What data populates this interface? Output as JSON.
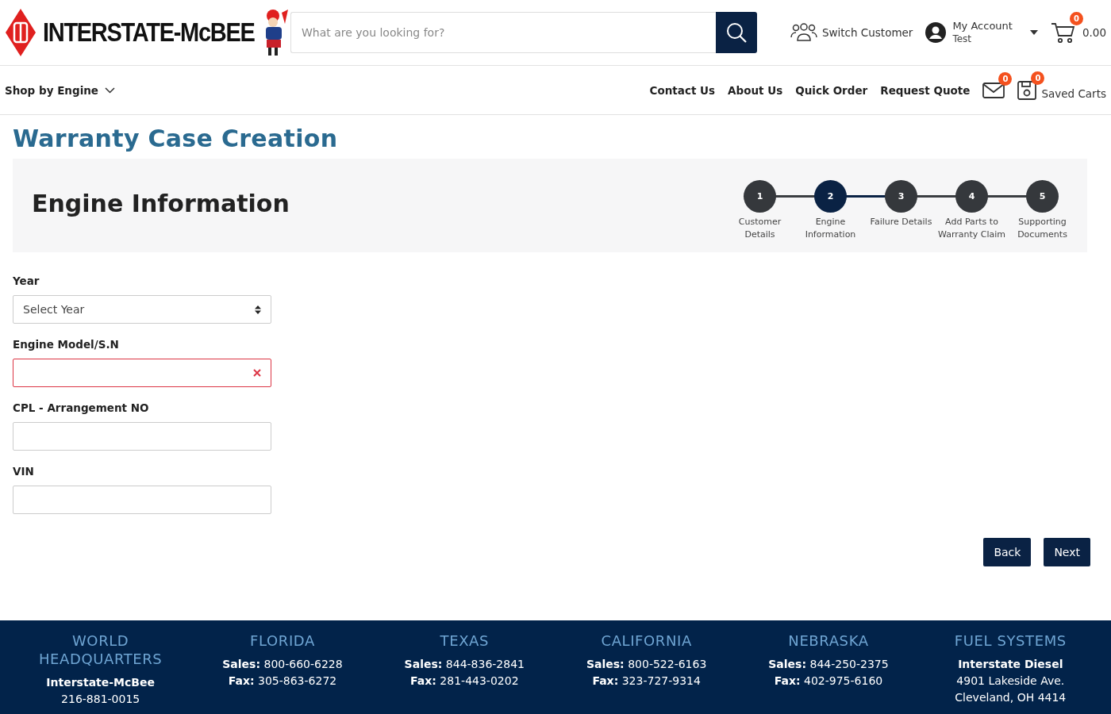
{
  "header": {
    "logo_text": "INTERSTATE-McBEE",
    "search": {
      "placeholder": "What are you looking for?"
    },
    "switch_customer": "Switch Customer",
    "account": {
      "label": "My Account",
      "user": "Test"
    },
    "cart": {
      "count": "0",
      "total": "0.00"
    }
  },
  "nav": {
    "shop_by": "Shop by Engine",
    "links": [
      "Contact Us",
      "About Us",
      "Quick Order",
      "Request Quote"
    ],
    "messages_count": "0",
    "saved_carts": {
      "count": "0",
      "label": "Saved Carts"
    }
  },
  "page_title": "Warranty Case Creation",
  "section_title": "Engine Information",
  "steps": [
    {
      "number": "1",
      "label": "Customer Details",
      "selected": false
    },
    {
      "number": "2",
      "label": "Engine Information",
      "selected": true
    },
    {
      "number": "3",
      "label": "Failure Details",
      "selected": false
    },
    {
      "number": "4",
      "label": "Add Parts to Warranty Claim",
      "selected": false
    },
    {
      "number": "5",
      "label": "Supporting Documents",
      "selected": false
    }
  ],
  "fields": [
    {
      "label": "Year",
      "kind": "select",
      "value": "Select Year",
      "invalid": false
    },
    {
      "label": "Engine Model/S.N",
      "kind": "text",
      "invalid": true
    },
    {
      "label": "CPL - Arrangement NO",
      "kind": "text",
      "invalid": false
    },
    {
      "label": "VIN",
      "kind": "text",
      "invalid": false
    }
  ],
  "buttons": [
    "Back",
    "Next"
  ],
  "footer": [
    {
      "title": "WORLD HEADQUARTERS",
      "lines": [
        {
          "text": "Interstate-McBee",
          "kind": "name"
        },
        {
          "text": "216-881-0015",
          "kind": "plain"
        }
      ]
    },
    {
      "title": "FLORIDA",
      "lines": [
        {
          "text": "**Sales:** 800-660-6228",
          "kind": "plain"
        },
        {
          "text": "**Fax:** 305-863-6272",
          "kind": "plain"
        }
      ]
    },
    {
      "title": "TEXAS",
      "lines": [
        {
          "text": "**Sales:** 844-836-2841",
          "kind": "plain"
        },
        {
          "text": "**Fax:** 281-443-0202",
          "kind": "plain"
        }
      ]
    },
    {
      "title": "CALIFORNIA",
      "lines": [
        {
          "text": "**Sales:** 800-522-6163",
          "kind": "plain"
        },
        {
          "text": "**Fax:** 323-727-9314",
          "kind": "plain"
        }
      ]
    },
    {
      "title": "NEBRASKA",
      "lines": [
        {
          "text": "**Sales:** 844-250-2375",
          "kind": "plain"
        },
        {
          "text": "**Fax:** 402-975-6160",
          "kind": "plain"
        }
      ]
    },
    {
      "title": "FUEL SYSTEMS",
      "lines": [
        {
          "text": "Interstate Diesel",
          "kind": "name"
        },
        {
          "text": "4901 Lakeside Ave.",
          "kind": "plain"
        },
        {
          "text": "Cleveland, OH 4414",
          "kind": "plain"
        }
      ]
    }
  ]
}
